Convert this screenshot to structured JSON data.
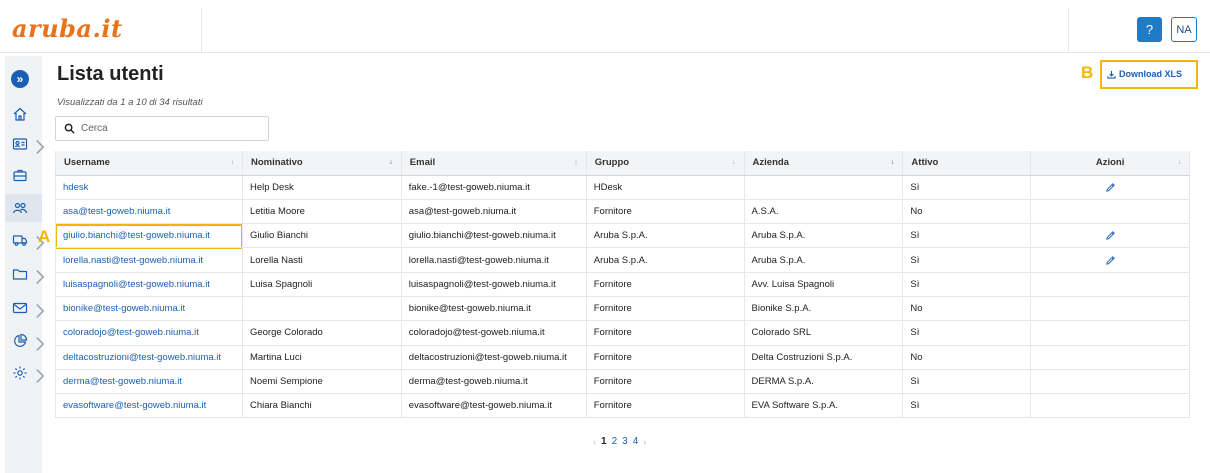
{
  "header": {
    "logo": "aruba.it",
    "help_label": "?",
    "user_initials": "NA"
  },
  "sidebar": {
    "expand_label": "»",
    "items": [
      {
        "icon": "home-icon"
      },
      {
        "icon": "contacts-card-icon"
      },
      {
        "icon": "briefcase-icon"
      },
      {
        "icon": "users-icon"
      },
      {
        "icon": "truck-icon"
      },
      {
        "icon": "folder-icon"
      },
      {
        "icon": "mail-icon"
      },
      {
        "icon": "pie-chart-icon"
      },
      {
        "icon": "gear-icon"
      }
    ]
  },
  "page": {
    "title": "Lista utenti",
    "results_text": "Visualizzati da 1 a 10 di 34 risultati",
    "search_placeholder": "Cerca",
    "download_label": "Download XLS"
  },
  "annotations": {
    "a": "A",
    "b": "B"
  },
  "table": {
    "columns": [
      "Username",
      "Nominativo",
      "Email",
      "Gruppo",
      "Azienda",
      "Attivo",
      "Azioni"
    ],
    "rows": [
      {
        "username": "hdesk",
        "nominativo": "Help Desk",
        "email": "fake.-1@test-goweb.niuma.it",
        "gruppo": "HDesk",
        "azienda": "",
        "attivo": "Sì",
        "edit": true
      },
      {
        "username": "asa@test-goweb.niuma.it",
        "nominativo": "Letitia Moore",
        "email": "asa@test-goweb.niuma.it",
        "gruppo": "Fornitore",
        "azienda": "A.S.A.",
        "attivo": "No",
        "edit": false
      },
      {
        "username": "giulio.bianchi@test-goweb.niuma.it",
        "nominativo": "Giulio Bianchi",
        "email": "giulio.bianchi@test-goweb.niuma.it",
        "gruppo": "Aruba S.p.A.",
        "azienda": "Aruba S.p.A.",
        "attivo": "Sì",
        "edit": true
      },
      {
        "username": "lorella.nasti@test-goweb.niuma.it",
        "nominativo": "Lorella Nasti",
        "email": "lorella.nasti@test-goweb.niuma.it",
        "gruppo": "Aruba S.p.A.",
        "azienda": "Aruba S.p.A.",
        "attivo": "Sì",
        "edit": true
      },
      {
        "username": "luisaspagnoli@test-goweb.niuma.it",
        "nominativo": "Luisa Spagnoli",
        "email": "luisaspagnoli@test-goweb.niuma.it",
        "gruppo": "Fornitore",
        "azienda": "Avv. Luisa Spagnoli",
        "attivo": "Sì",
        "edit": false
      },
      {
        "username": "bionike@test-goweb.niuma.it",
        "nominativo": "",
        "email": "bionike@test-goweb.niuma.it",
        "gruppo": "Fornitore",
        "azienda": "Bionike S.p.A.",
        "attivo": "No",
        "edit": false
      },
      {
        "username": "coloradojo@test-goweb.niuma.it",
        "nominativo": "George Colorado",
        "email": "coloradojo@test-goweb.niuma.it",
        "gruppo": "Fornitore",
        "azienda": "Colorado SRL",
        "attivo": "Sì",
        "edit": false
      },
      {
        "username": "deltacostruzioni@test-goweb.niuma.it",
        "nominativo": "Martina Luci",
        "email": "deltacostruzioni@test-goweb.niuma.it",
        "gruppo": "Fornitore",
        "azienda": "Delta Costruzioni S.p.A.",
        "attivo": "No",
        "edit": false
      },
      {
        "username": "derma@test-goweb.niuma.it",
        "nominativo": "Noemi Sempione",
        "email": "derma@test-goweb.niuma.it",
        "gruppo": "Fornitore",
        "azienda": "DERMA S.p.A.",
        "attivo": "Sì",
        "edit": false
      },
      {
        "username": "evasoftware@test-goweb.niuma.it",
        "nominativo": "Chiara Bianchi",
        "email": "evasoftware@test-goweb.niuma.it",
        "gruppo": "Fornitore",
        "azienda": "EVA Software S.p.A.",
        "attivo": "Sì",
        "edit": false
      }
    ]
  },
  "pagination": {
    "prev": "‹",
    "pages": [
      "1",
      "2",
      "3",
      "4"
    ],
    "current": "1",
    "next": "›"
  }
}
